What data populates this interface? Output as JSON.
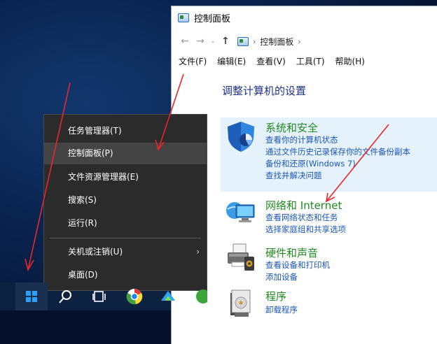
{
  "window": {
    "title": "控制面板",
    "nav": {
      "back": "←",
      "forward": "→",
      "recent": "⌄",
      "up": "↑"
    },
    "breadcrumb": [
      "控制面板"
    ],
    "menu": [
      "文件(F)",
      "编辑(E)",
      "查看(V)",
      "工具(T)",
      "帮助(H)"
    ],
    "heading": "调整计算机的设置",
    "sections": [
      {
        "title": "系统和安全",
        "icon": "shield-icon",
        "links": [
          "查看你的计算机状态",
          "通过文件历史记录保存你的文件备份副本",
          "备份和还原(Windows 7)",
          "查找并解决问题"
        ]
      },
      {
        "title": "网络和 Internet",
        "icon": "network-globe-icon",
        "links": [
          "查看网络状态和任务",
          "选择家庭组和共享选项"
        ]
      },
      {
        "title": "硬件和声音",
        "icon": "printer-icon",
        "links": [
          "查看设备和打印机",
          "添加设备"
        ]
      },
      {
        "title": "程序",
        "icon": "program-box-icon",
        "links": [
          "卸载程序"
        ]
      }
    ]
  },
  "start_menu": {
    "items": [
      "任务管理器(T)",
      "控制面板(P)",
      "文件资源管理器(E)",
      "搜索(S)",
      "运行(R)",
      "关机或注销(U)",
      "桌面(D)"
    ],
    "active_item": "控制面板(P)",
    "submenu_chevron": "›"
  },
  "colors": {
    "arrow": "#e8262b",
    "section_title": "#228a22",
    "link": "#1b57b8",
    "heading": "#1e3287",
    "menu_bg": "#2b2b2b",
    "highlight": "#e5f1fb"
  }
}
